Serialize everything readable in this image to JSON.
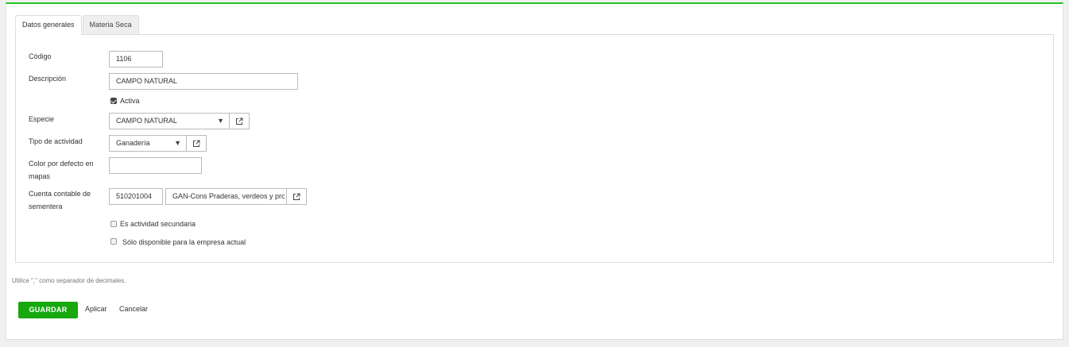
{
  "tabs": [
    {
      "label": "Datos generales",
      "active": true
    },
    {
      "label": "Materia Seca",
      "active": false
    }
  ],
  "form": {
    "codigo": {
      "label": "Código",
      "value": "1106"
    },
    "descripcion": {
      "label": "Descripción",
      "value": "CAMPO NATURAL"
    },
    "activa": {
      "label": "Activa",
      "checked": true
    },
    "especie": {
      "label": "Especie",
      "value": "CAMPO NATURAL"
    },
    "tipo_actividad": {
      "label": "Tipo de actividad",
      "value": "Ganadería"
    },
    "color": {
      "label_line1": "Color por defecto en",
      "label_line2": "mapas",
      "value": ""
    },
    "cuenta": {
      "label_line1": "Cuenta contable de",
      "label_line2": "sementera",
      "code": "510201004",
      "name": "GAN-Cons Praderas, verdeos y prc"
    },
    "secundaria": {
      "label": "Es actividad secundaria",
      "checked": false
    },
    "solo_empresa": {
      "label": "Sólo disponible para la empresa actual",
      "checked": false
    }
  },
  "footer": {
    "note": "Utilice \",\" como separador de decimales.",
    "save_label": "GUARDAR",
    "apply_label": "Aplicar",
    "cancel_label": "Cancelar"
  },
  "colors": {
    "accent": "#22c41e",
    "save_button": "#17a80f"
  },
  "icons": {
    "external_link": "external-link-icon",
    "dropdown_caret": "caret-down-icon"
  }
}
